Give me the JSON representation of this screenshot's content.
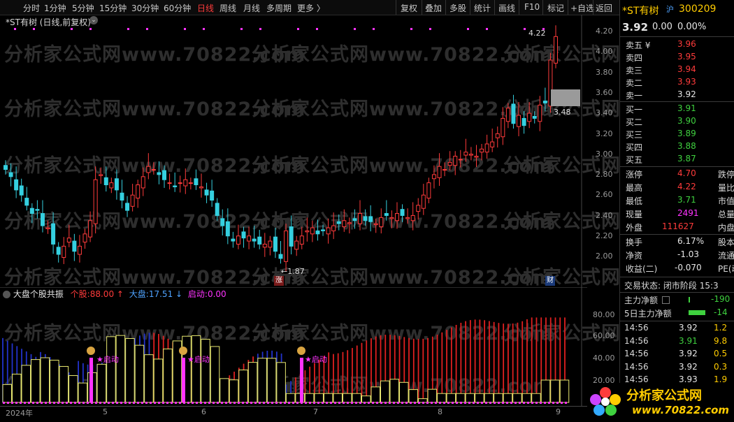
{
  "toolbar": {
    "left_tabs": [
      "分时",
      "1分钟",
      "5分钟",
      "15分钟",
      "30分钟",
      "60分钟",
      "日线",
      "周线",
      "月线",
      "多周期",
      "更多 〉"
    ],
    "active_tab": "日线",
    "right_buttons": [
      "复权",
      "叠加",
      "多股",
      "统计",
      "画线",
      "F10",
      "标记",
      "+自选",
      "返回"
    ]
  },
  "main_chart": {
    "title": "*ST有树 (日线,前复权)",
    "y_ticks": [
      "4.20",
      "4.00",
      "3.80",
      "3.60",
      "3.40",
      "3.20",
      "3.00",
      "2.80",
      "2.60",
      "2.40",
      "2.20",
      "2.00"
    ],
    "high_label": "4.22",
    "low_label": "1.87",
    "current_label": "3.48",
    "marker_zhang": "涨",
    "marker_cai": "财"
  },
  "indicator": {
    "name": "大盘个股共振",
    "gegu_label": "个股:",
    "gegu_value": "88.00",
    "dapan_label": "大盘:",
    "dapan_value": "17.51",
    "qidong_label": "启动:",
    "qidong_value": "0.00",
    "y_ticks": [
      "80.00",
      "60.00",
      "40.00",
      "20.00"
    ],
    "signal_label": "★启动"
  },
  "x_axis": {
    "labels": [
      "2024年",
      "5",
      "6",
      "7",
      "8",
      "9"
    ]
  },
  "watermark": {
    "texts": [
      "分析家公式网www.70822.com"
    ]
  },
  "quote": {
    "name": "*ST有树",
    "exchange": "沪",
    "code": "300209",
    "price": "3.92",
    "change": "0.00",
    "change_pct": "0.00%",
    "asks": [
      {
        "label": "卖五 ¥",
        "price": "3.96"
      },
      {
        "label": "卖四",
        "price": "3.95"
      },
      {
        "label": "卖三",
        "price": "3.94"
      },
      {
        "label": "卖二",
        "price": "3.93"
      },
      {
        "label": "卖一",
        "price": "3.92"
      }
    ],
    "bids": [
      {
        "label": "买一",
        "price": "3.91"
      },
      {
        "label": "买二",
        "price": "3.90"
      },
      {
        "label": "买三",
        "price": "3.89"
      },
      {
        "label": "买四",
        "price": "3.88"
      },
      {
        "label": "买五",
        "price": "3.87"
      }
    ],
    "stats1": [
      {
        "label": "涨停",
        "value": "4.70",
        "label2": "跌停"
      },
      {
        "label": "最高",
        "value": "4.22",
        "label2": "量比"
      },
      {
        "label": "最低",
        "value": "3.71",
        "label2": "市值"
      },
      {
        "label": "现量",
        "value": "2491",
        "label2": "总量"
      },
      {
        "label": "外盘",
        "value": "111627",
        "label2": "内盘"
      }
    ],
    "stats2": [
      {
        "label": "换手",
        "value": "6.17%",
        "label2": "股本"
      },
      {
        "label": "净资",
        "value": "-1.03",
        "label2": "流通"
      },
      {
        "label": "收益(二)",
        "value": "-0.070",
        "label2": "PE(动"
      }
    ],
    "status_label": "交易状态:",
    "status_value": "闭市阶段",
    "status_time": "15:3",
    "flow1_label": "主力净额",
    "flow1_value": "-190",
    "flow2_label": "5日主力净额",
    "flow2_value": "-14",
    "ticks": [
      {
        "time": "14:56",
        "price": "3.92",
        "vol": "1.2"
      },
      {
        "time": "14:56",
        "price": "3.91",
        "vol": "9.8"
      },
      {
        "time": "14:56",
        "price": "3.92",
        "vol": "0.5"
      },
      {
        "time": "14:56",
        "price": "3.92",
        "vol": "0.3"
      },
      {
        "time": "14:56",
        "price": "3.93",
        "vol": "1.9"
      }
    ]
  },
  "logo": {
    "text": "分析家公式网",
    "url": "www.70822.com"
  },
  "colors": {
    "up": "#ff3b3b",
    "down": "#3fd13f",
    "candle_down": "#35d0e0",
    "signal": "#ff33ff",
    "dapan": "#3344dd"
  }
}
